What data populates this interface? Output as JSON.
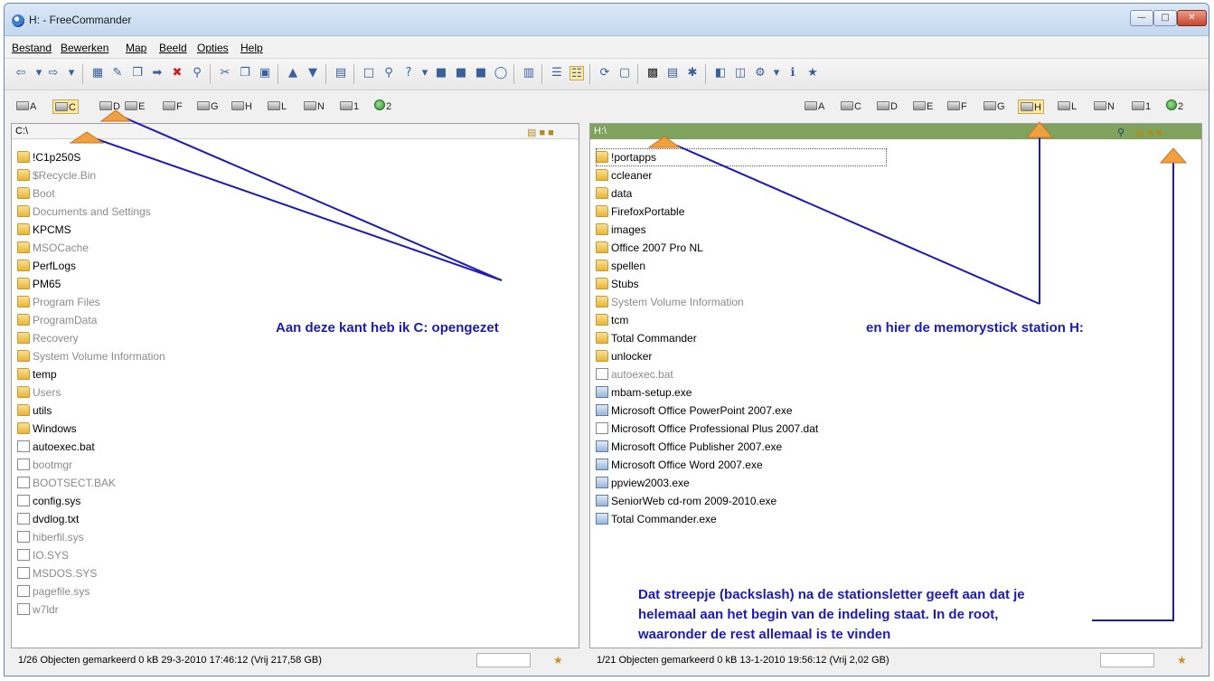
{
  "window": {
    "title": "H: - FreeCommander"
  },
  "menu": [
    "Bestand",
    "Bewerken",
    "Map",
    "Beeld",
    "Opties",
    "Help"
  ],
  "drives": {
    "left": [
      {
        "letter": "A"
      },
      {
        "letter": "C"
      },
      {
        "letter": "D"
      },
      {
        "letter": "E"
      },
      {
        "letter": "F"
      },
      {
        "letter": "G"
      },
      {
        "letter": "H"
      },
      {
        "letter": "L"
      },
      {
        "letter": "N"
      },
      {
        "letter": "1"
      },
      {
        "letter": "2"
      }
    ],
    "right": [
      {
        "letter": "A"
      },
      {
        "letter": "C"
      },
      {
        "letter": "D"
      },
      {
        "letter": "E"
      },
      {
        "letter": "F"
      },
      {
        "letter": "G"
      },
      {
        "letter": "H"
      },
      {
        "letter": "L"
      },
      {
        "letter": "N"
      },
      {
        "letter": "1"
      },
      {
        "letter": "2"
      }
    ]
  },
  "left_panel": {
    "path": "C:\\",
    "files": [
      {
        "name": "!C1p250S",
        "type": "folder",
        "dim": false
      },
      {
        "name": "$Recycle.Bin",
        "type": "folder",
        "dim": true
      },
      {
        "name": "Boot",
        "type": "folder",
        "dim": true
      },
      {
        "name": "Documents and Settings",
        "type": "folder",
        "dim": true
      },
      {
        "name": "KPCMS",
        "type": "folder",
        "dim": false
      },
      {
        "name": "MSOCache",
        "type": "folder",
        "dim": true
      },
      {
        "name": "PerfLogs",
        "type": "folder",
        "dim": false
      },
      {
        "name": "PM65",
        "type": "folder",
        "dim": false
      },
      {
        "name": "Program Files",
        "type": "folder",
        "dim": true
      },
      {
        "name": "ProgramData",
        "type": "folder",
        "dim": true
      },
      {
        "name": "Recovery",
        "type": "folder",
        "dim": true
      },
      {
        "name": "System Volume Information",
        "type": "folder",
        "dim": true
      },
      {
        "name": "temp",
        "type": "folder",
        "dim": false
      },
      {
        "name": "Users",
        "type": "folder",
        "dim": true
      },
      {
        "name": "utils",
        "type": "folder",
        "dim": false
      },
      {
        "name": "Windows",
        "type": "folder",
        "dim": false
      },
      {
        "name": "autoexec.bat",
        "type": "file",
        "dim": false
      },
      {
        "name": "bootmgr",
        "type": "file",
        "dim": true
      },
      {
        "name": "BOOTSECT.BAK",
        "type": "file",
        "dim": true
      },
      {
        "name": "config.sys",
        "type": "file",
        "dim": false
      },
      {
        "name": "dvdlog.txt",
        "type": "file",
        "dim": false
      },
      {
        "name": "hiberfil.sys",
        "type": "file",
        "dim": true
      },
      {
        "name": "IO.SYS",
        "type": "file",
        "dim": true
      },
      {
        "name": "MSDOS.SYS",
        "type": "file",
        "dim": true
      },
      {
        "name": "pagefile.sys",
        "type": "file",
        "dim": true
      },
      {
        "name": "w7ldr",
        "type": "file",
        "dim": true
      }
    ],
    "status": "1/26 Objecten gemarkeerd   0 kB  29-3-2010 17:46:12     (Vrij 217,58 GB)"
  },
  "right_panel": {
    "path": "H:\\",
    "files": [
      {
        "name": "!portapps",
        "type": "folder",
        "dim": false,
        "selected": true
      },
      {
        "name": "ccleaner",
        "type": "folder",
        "dim": false
      },
      {
        "name": "data",
        "type": "folder",
        "dim": false
      },
      {
        "name": "FirefoxPortable",
        "type": "folder",
        "dim": false
      },
      {
        "name": "images",
        "type": "folder",
        "dim": false
      },
      {
        "name": "Office 2007 Pro NL",
        "type": "folder",
        "dim": false
      },
      {
        "name": "spellen",
        "type": "folder",
        "dim": false
      },
      {
        "name": "Stubs",
        "type": "folder",
        "dim": false
      },
      {
        "name": "System Volume Information",
        "type": "folder",
        "dim": true
      },
      {
        "name": "tcm",
        "type": "folder",
        "dim": false
      },
      {
        "name": "Total Commander",
        "type": "folder",
        "dim": false
      },
      {
        "name": "unlocker",
        "type": "folder",
        "dim": false
      },
      {
        "name": "autoexec.bat",
        "type": "file",
        "dim": true
      },
      {
        "name": "mbam-setup.exe",
        "type": "exe",
        "dim": false
      },
      {
        "name": "Microsoft Office PowerPoint 2007.exe",
        "type": "exe",
        "dim": false
      },
      {
        "name": "Microsoft Office Professional Plus 2007.dat",
        "type": "file",
        "dim": false
      },
      {
        "name": "Microsoft Office Publisher 2007.exe",
        "type": "exe",
        "dim": false
      },
      {
        "name": "Microsoft Office Word 2007.exe",
        "type": "exe",
        "dim": false
      },
      {
        "name": "ppview2003.exe",
        "type": "exe",
        "dim": false
      },
      {
        "name": "SeniorWeb cd-rom 2009-2010.exe",
        "type": "exe",
        "dim": false
      },
      {
        "name": "Total Commander.exe",
        "type": "exe",
        "dim": false
      }
    ],
    "status": "1/21 Objecten gemarkeerd   0 kB  13-1-2010 19:56:12     (Vrij 2,02 GB)"
  },
  "annotations": {
    "left": "Aan deze kant heb ik C: opengezet",
    "right": "en hier de memorystick station H:",
    "bottom_lines": [
      "Dat streepje (backslash) na de stationsletter geeft aan dat je",
      "helemaal aan het begin van de indeling staat. In de root,",
      "waaronder de rest allemaal is te vinden"
    ]
  },
  "colors": {
    "annotation": "#1c1cb4",
    "arrow": "#e8913a",
    "active_path": "#7fa35c"
  }
}
